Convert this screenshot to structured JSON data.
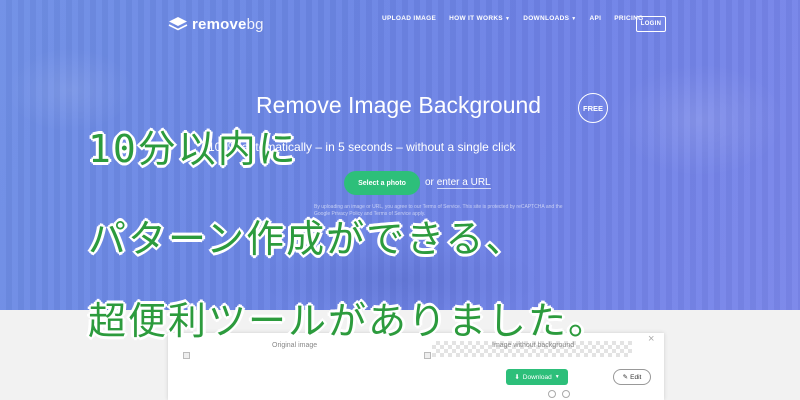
{
  "header": {
    "logo_text_bold": "remove",
    "logo_text_light": "bg",
    "nav": [
      {
        "label": "UPLOAD IMAGE",
        "has_dropdown": false
      },
      {
        "label": "HOW IT WORKS",
        "has_dropdown": true
      },
      {
        "label": "DOWNLOADS",
        "has_dropdown": true
      },
      {
        "label": "API",
        "has_dropdown": false
      },
      {
        "label": "PRICING",
        "has_dropdown": false
      }
    ],
    "login_label": "LOGIN"
  },
  "hero": {
    "title": "Remove Image Background",
    "badge": "FREE",
    "subtitle": "100% automatically – in 5 seconds – without a single click",
    "select_button": "Select a photo",
    "or_text": "or",
    "url_link": "enter a URL",
    "terms": "By uploading an image or URL, you agree to our Terms of Service. This site is protected by reCAPTCHA and the Google Privacy Policy and Terms of Service apply."
  },
  "overlay": {
    "line1": "10分以内に",
    "line2": "パターン作成ができる、",
    "line3": "超便利ツールがありました。"
  },
  "demo": {
    "original_label": "Original image",
    "nobg_label": "Image without background",
    "download_label": "Download",
    "edit_label": "Edit",
    "close_icon": "×"
  },
  "colors": {
    "accent_green": "#2dbf7a",
    "overlay_green": "#2c9b3d",
    "hero_blue": "#6b86e4"
  }
}
